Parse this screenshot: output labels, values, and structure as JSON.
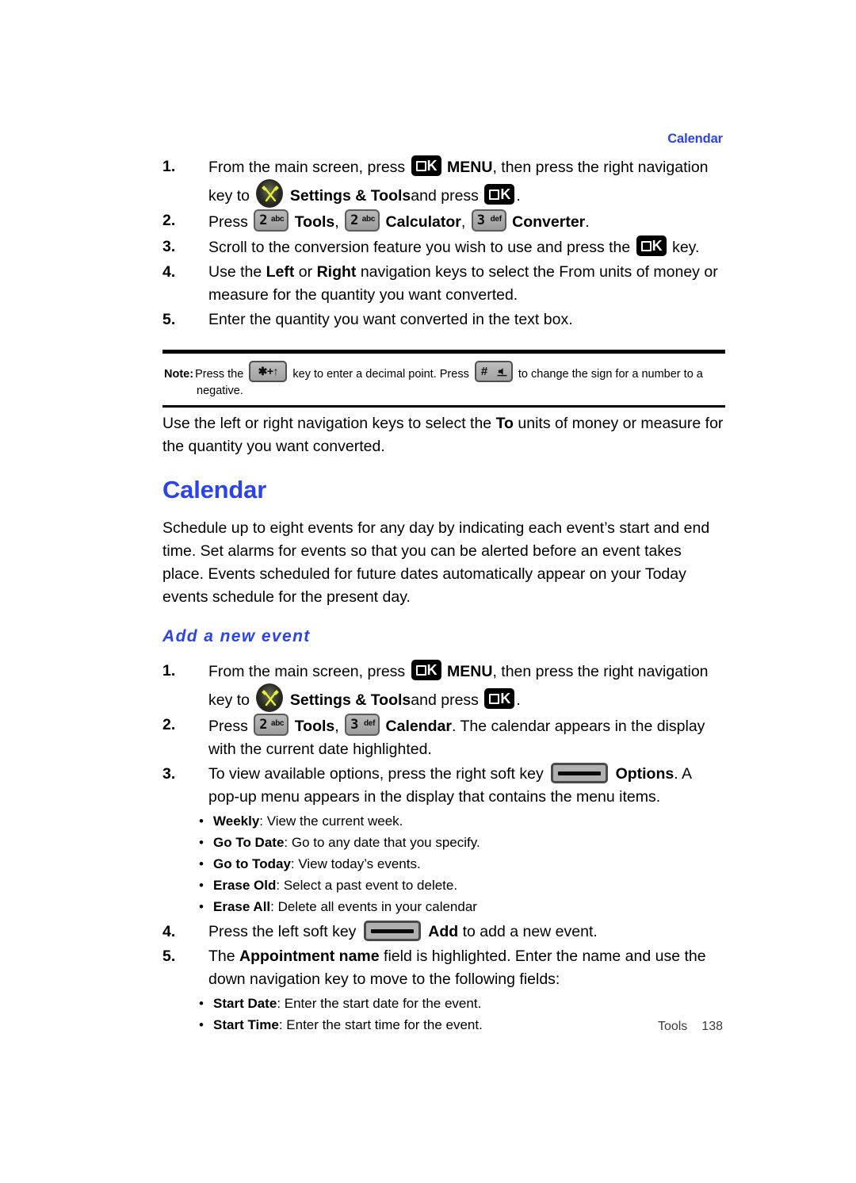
{
  "running_head": "Calendar",
  "converter_steps": [
    {
      "num": "1.",
      "seg_a": "From the main screen, press",
      "menu_label": "MENU",
      "seg_b": ", then press the right navigation key to",
      "settings_label": "Settings & Tools",
      "seg_c": "and press",
      "seg_d": "."
    },
    {
      "num": "2.",
      "seg_a": "Press",
      "key1_digit": "2",
      "key1_sub": "abc",
      "bold1": "Tools",
      "sep1": ",",
      "key2_digit": "2",
      "key2_sub": "abc",
      "bold2": "Calculator",
      "sep2": ",",
      "key3_digit": "3",
      "key3_sub": "def",
      "bold3": "Converter",
      "end": "."
    },
    {
      "num": "3.",
      "seg_a": "Scroll to the conversion feature you wish to use and press the",
      "seg_b": "key."
    },
    {
      "num": "4.",
      "seg_a": "Use the",
      "bold1": "Left",
      "seg_b": "or",
      "bold2": "Right",
      "seg_c": "navigation keys to select the From units of money or measure for the quantity you want converted."
    },
    {
      "num": "5.",
      "seg_a": "Enter the quantity you want converted in the text box."
    }
  ],
  "note": {
    "label": "Note:",
    "seg_a": "Press the",
    "star_glyphs": "✱+↑",
    "seg_b": "key to enter a decimal point. Press",
    "pound_hash": "#",
    "seg_c": "to change the sign for a number to a",
    "seg_d": "negative."
  },
  "to_units_para": {
    "seg_a": "Use the left or right navigation keys to select the",
    "bold": "To",
    "seg_b": "units of money or measure for the quantity you want converted."
  },
  "calendar_section": {
    "heading": "Calendar",
    "intro": "Schedule up to eight events for any day by indicating each event’s start and end time. Set alarms for events so that you can be alerted before an event takes place. Events scheduled for future dates automatically appear on your Today events schedule for the present day.",
    "subheading": "Add a new event"
  },
  "event_steps": [
    {
      "num": "1.",
      "seg_a": "From the main screen, press",
      "menu_label": "MENU",
      "seg_b": ", then press the right navigation key to",
      "settings_label": "Settings & Tools",
      "seg_c": "and press",
      "seg_d": "."
    },
    {
      "num": "2.",
      "seg_a": "Press",
      "key1_digit": "2",
      "key1_sub": "abc",
      "bold1": "Tools",
      "sep1": ",",
      "key2_digit": "3",
      "key2_sub": "def",
      "bold2": "Calendar",
      "seg_b": ". The calendar appears in the display with the current date highlighted."
    },
    {
      "num": "3.",
      "seg_a": "To view available options, press the right soft key",
      "bold1": "Options",
      "seg_b": ". A pop-up menu appears in the display that contains the menu items."
    },
    {
      "num": "4.",
      "seg_a": "Press the left soft key",
      "bold1": "Add",
      "seg_b": "to add a new event."
    },
    {
      "num": "5.",
      "seg_a": "The",
      "bold1": "Appointment name",
      "seg_b": "field is highlighted. Enter the name and use the down navigation key to move to the following fields:"
    }
  ],
  "options_bullets": [
    {
      "term": "Weekly",
      "desc": ": View the current week."
    },
    {
      "term": "Go To Date",
      "desc": ": Go to any date that you specify."
    },
    {
      "term": "Go to Today",
      "desc": ": View today’s events."
    },
    {
      "term": "Erase Old",
      "desc": ": Select a past event to delete."
    },
    {
      "term": "Erase All",
      "desc": ": Delete all events in your calendar"
    }
  ],
  "field_bullets": [
    {
      "term": "Start Date",
      "desc": ": Enter the start date for the event."
    },
    {
      "term": "Start Time",
      "desc": ": Enter the start time for the event."
    }
  ],
  "footer": {
    "label": "Tools",
    "page": "138"
  },
  "colors": {
    "heading_blue": "#2B44E8",
    "body_black": "#000000",
    "key_gray": "#b0b0b0"
  }
}
